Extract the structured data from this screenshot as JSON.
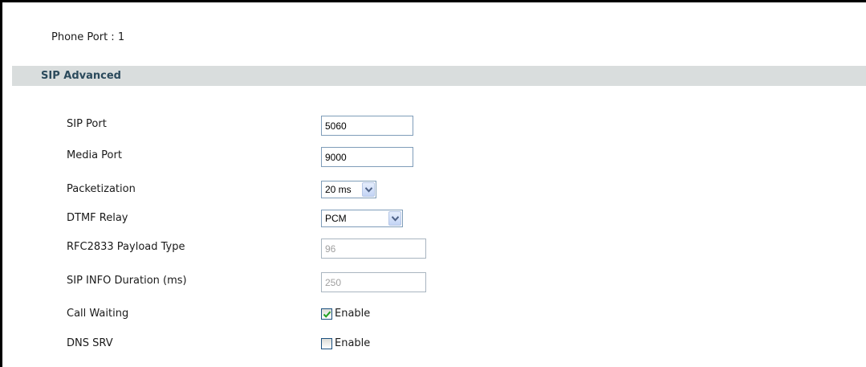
{
  "phone_port_label": "Phone Port : 1",
  "section": {
    "title": "SIP Advanced"
  },
  "fields": {
    "sip_port": {
      "label": "SIP Port",
      "value": "5060"
    },
    "media_port": {
      "label": "Media Port",
      "value": "9000"
    },
    "packetization": {
      "label": "Packetization",
      "value": "20 ms"
    },
    "dtmf_relay": {
      "label": "DTMF Relay",
      "value": "PCM"
    },
    "rfc2833_payload_type": {
      "label": "RFC2833 Payload Type",
      "value": "96"
    },
    "sip_info_duration": {
      "label": "SIP INFO Duration (ms)",
      "value": "250"
    },
    "call_waiting": {
      "label": "Call Waiting",
      "option_label": "Enable",
      "checked": true
    },
    "dns_srv": {
      "label": "DNS SRV",
      "option_label": "Enable",
      "checked": false
    }
  },
  "colors": {
    "section_bg": "#d9dddd",
    "section_title": "#2b4a5c",
    "input_border": "#7f9db9",
    "checkmark": "#21a121"
  },
  "icons": {
    "dropdown": "chevron-down-icon",
    "check": "checkmark-icon"
  }
}
